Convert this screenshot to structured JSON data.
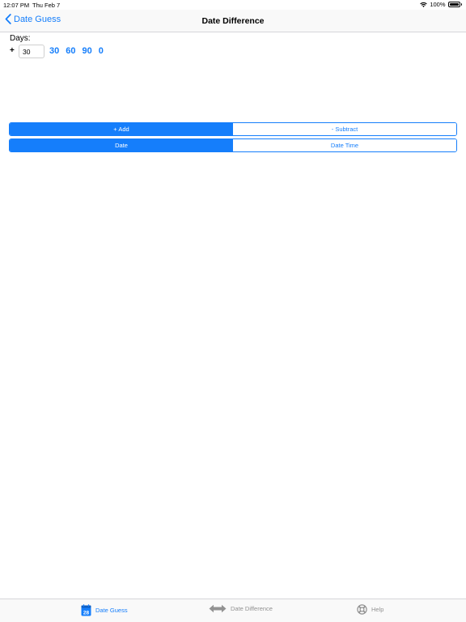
{
  "status_bar": {
    "time": "12:07 PM",
    "date": "Thu Feb 7",
    "battery": "100%"
  },
  "nav": {
    "back_label": "Date Guess",
    "title": "Date Difference"
  },
  "days": {
    "label": "Days:",
    "sign": "+",
    "input_value": "30",
    "quick_values": [
      "30",
      "60",
      "90",
      "0"
    ]
  },
  "operation_control": {
    "segments": [
      "+ Add",
      "- Subtract"
    ],
    "selected": "+ Add"
  },
  "mode_control": {
    "segments": [
      "Date",
      "Date Time"
    ],
    "selected": "Date"
  },
  "tab_bar": {
    "items": [
      {
        "label": "Date Guess",
        "icon": "calendar-icon",
        "active": true,
        "badge": "28"
      },
      {
        "label": "Date Difference",
        "icon": "double-arrow-icon",
        "active": false
      },
      {
        "label": "Help",
        "icon": "lifebuoy-icon",
        "active": false
      }
    ]
  },
  "colors": {
    "accent": "#157efb",
    "inactive_tab": "#929292"
  }
}
